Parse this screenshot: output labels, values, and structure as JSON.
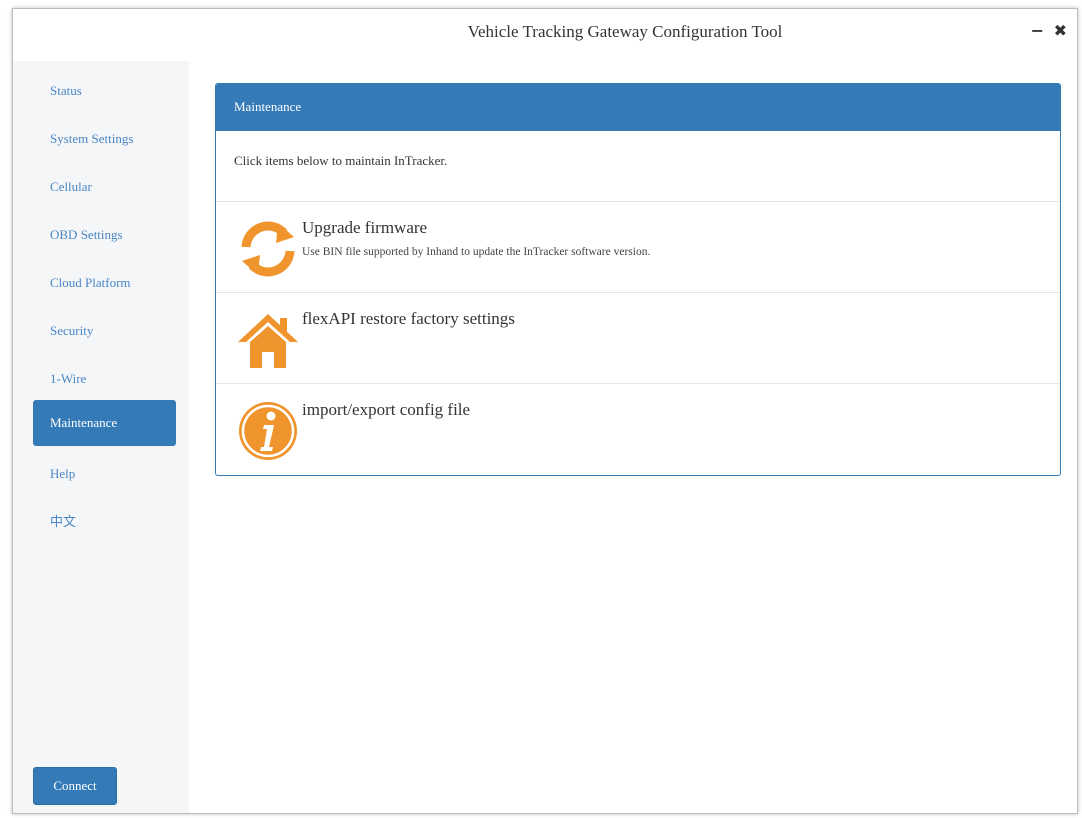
{
  "window": {
    "title": "Vehicle Tracking Gateway Configuration Tool",
    "minimize_label": "−",
    "close_label": "✖"
  },
  "sidebar": {
    "items": [
      {
        "label": "Status",
        "active": false
      },
      {
        "label": "System Settings",
        "active": false
      },
      {
        "label": "Cellular",
        "active": false
      },
      {
        "label": "OBD Settings",
        "active": false
      },
      {
        "label": "Cloud Platform",
        "active": false
      },
      {
        "label": "Security",
        "active": false
      },
      {
        "label": "1-Wire",
        "active": false
      },
      {
        "label": "Maintenance",
        "active": true
      },
      {
        "label": "Help",
        "active": false
      },
      {
        "label": "中文",
        "active": false
      }
    ],
    "connect_label": "Connect"
  },
  "panel": {
    "heading": "Maintenance",
    "intro": "Click items below to maintain InTracker.",
    "items": [
      {
        "title": "Upgrade firmware",
        "desc": "Use BIN file supported by Inhand to update the InTracker software version.",
        "icon": "refresh-icon"
      },
      {
        "title": "flexAPI restore factory settings",
        "desc": "",
        "icon": "home-icon"
      },
      {
        "title": "import/export config file",
        "desc": "",
        "icon": "info-icon"
      }
    ]
  },
  "colors": {
    "accent": "#337ab7",
    "icon_orange": "#f0952d",
    "link": "#4a86c5"
  }
}
